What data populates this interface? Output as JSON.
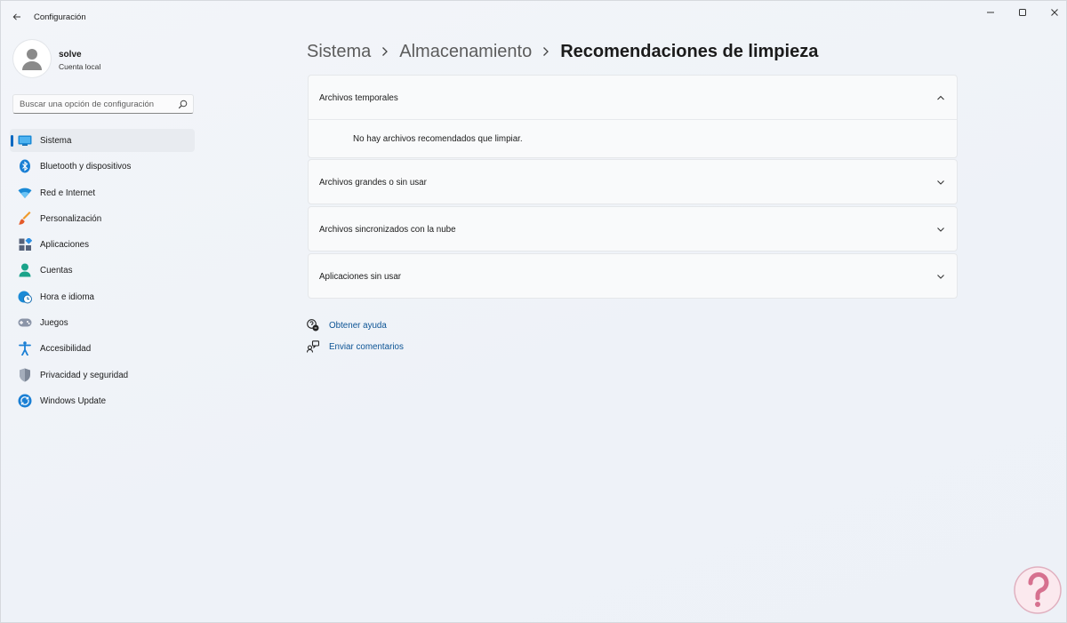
{
  "window": {
    "title": "Configuración",
    "controls": [
      "minimize-icon",
      "maximize-icon",
      "close-icon"
    ]
  },
  "profile": {
    "name": "solve",
    "account_type": "Cuenta local"
  },
  "search": {
    "placeholder": "Buscar una opción de configuración",
    "icon": "search-icon"
  },
  "sidebar": {
    "items": [
      {
        "label": "Sistema",
        "icon": "display-icon",
        "active": true
      },
      {
        "label": "Bluetooth y dispositivos",
        "icon": "bluetooth-icon"
      },
      {
        "label": "Red e Internet",
        "icon": "wifi-icon"
      },
      {
        "label": "Personalización",
        "icon": "paintbrush-icon"
      },
      {
        "label": "Aplicaciones",
        "icon": "apps-icon"
      },
      {
        "label": "Cuentas",
        "icon": "person-icon"
      },
      {
        "label": "Hora e idioma",
        "icon": "clock-globe-icon"
      },
      {
        "label": "Juegos",
        "icon": "gamepad-icon"
      },
      {
        "label": "Accesibilidad",
        "icon": "accessibility-icon"
      },
      {
        "label": "Privacidad y seguridad",
        "icon": "shield-icon"
      },
      {
        "label": "Windows Update",
        "icon": "update-icon"
      }
    ]
  },
  "breadcrumb": {
    "items": [
      "Sistema",
      "Almacenamiento",
      "Recomendaciones de limpieza"
    ]
  },
  "sections": [
    {
      "title": "Archivos temporales",
      "expanded": true,
      "body": "No hay archivos recomendados que limpiar."
    },
    {
      "title": "Archivos grandes o sin usar",
      "expanded": false
    },
    {
      "title": "Archivos sincronizados con la nube",
      "expanded": false
    },
    {
      "title": "Aplicaciones sin usar",
      "expanded": false
    }
  ],
  "links": {
    "help": "Obtener ayuda",
    "feedback": "Enviar comentarios"
  },
  "colors": {
    "accent": "#0067c0",
    "link": "#0b5394",
    "background": "#eef2f7"
  }
}
